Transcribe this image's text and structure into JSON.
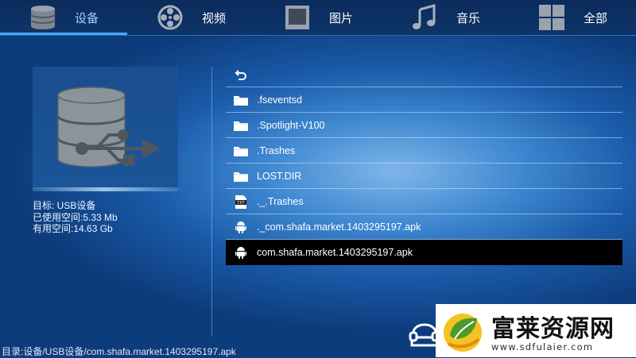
{
  "nav": {
    "tabs": [
      {
        "label": "设备",
        "icon": "database-icon",
        "active": true
      },
      {
        "label": "视频",
        "icon": "film-reel-icon",
        "active": false
      },
      {
        "label": "图片",
        "icon": "picture-frame-icon",
        "active": false
      },
      {
        "label": "音乐",
        "icon": "music-note-icon",
        "active": false
      },
      {
        "label": "全部",
        "icon": "grid-icon",
        "active": false
      }
    ]
  },
  "device": {
    "icon": "usb-database-icon",
    "target": "目标: USB设备",
    "used": "已使用空间:5.33 Mb",
    "free": "有用空间:14.63 Gb"
  },
  "files": [
    {
      "name": "",
      "icon": "back-arrow-icon"
    },
    {
      "name": ".fseventsd",
      "icon": "folder-icon"
    },
    {
      "name": ".Spotlight-V100",
      "icon": "folder-icon"
    },
    {
      "name": ".Trashes",
      "icon": "folder-icon"
    },
    {
      "name": "LOST.DIR",
      "icon": "folder-icon"
    },
    {
      "name": "._.Trashes",
      "icon": "txt-file-icon"
    },
    {
      "name": "._com.shafa.market.1403295197.apk",
      "icon": "android-icon"
    },
    {
      "name": "com.shafa.market.1403295197.apk",
      "icon": "android-icon",
      "selected": true
    }
  ],
  "footer": {
    "path": "目录:设备/USB设备/com.shafa.market.1403295197.apk"
  },
  "watermark": {
    "title": "富莱资源网",
    "url": "www.sdfulaier.com"
  },
  "colors": {
    "accent": "#4aa8ff",
    "selected_row": "#000000",
    "topbar": "#0b2b5c"
  }
}
